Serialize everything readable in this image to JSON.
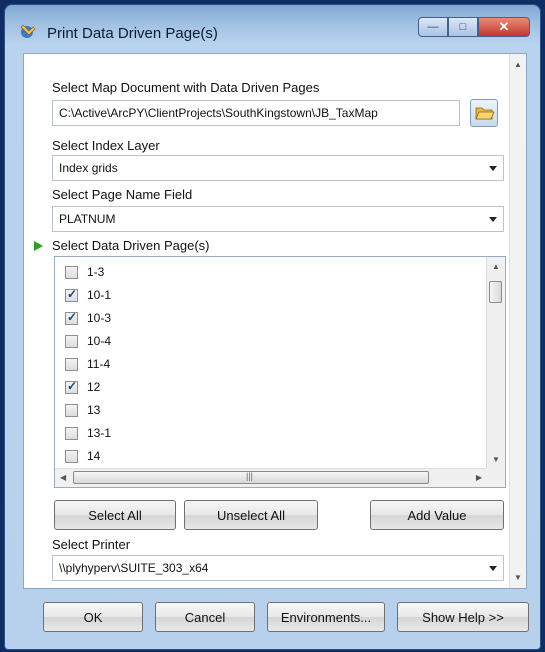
{
  "window": {
    "title": "Print Data Driven Page(s)",
    "icon": "arcgis-tool-icon",
    "controls": [
      "minimize-icon",
      "maximize-icon",
      "close-icon"
    ]
  },
  "map_document": {
    "label": "Select Map Document with Data Driven Pages",
    "value": "C:\\Active\\ArcPY\\ClientProjects\\SouthKingstown\\JB_TaxMap"
  },
  "index_layer": {
    "label": "Select Index Layer",
    "value": "Index grids"
  },
  "page_name_field": {
    "label": "Select Page Name Field",
    "value": "PLATNUM"
  },
  "pages": {
    "label": "Select Data Driven Page(s)",
    "items": [
      {
        "label": "1-3",
        "checked": false
      },
      {
        "label": "10-1",
        "checked": true
      },
      {
        "label": "10-3",
        "checked": true
      },
      {
        "label": "10-4",
        "checked": false
      },
      {
        "label": "11-4",
        "checked": false
      },
      {
        "label": "12",
        "checked": true
      },
      {
        "label": "13",
        "checked": false
      },
      {
        "label": "13-1",
        "checked": false
      },
      {
        "label": "14",
        "checked": false
      }
    ]
  },
  "list_buttons": {
    "select_all": "Select All",
    "unselect_all": "Unselect All",
    "add_value": "Add Value"
  },
  "printer": {
    "label": "Select Printer",
    "value": "\\\\plyhyperv\\SUITE_303_x64"
  },
  "footer": {
    "ok": "OK",
    "cancel": "Cancel",
    "environments": "Environments...",
    "show_help": "Show Help >>"
  }
}
